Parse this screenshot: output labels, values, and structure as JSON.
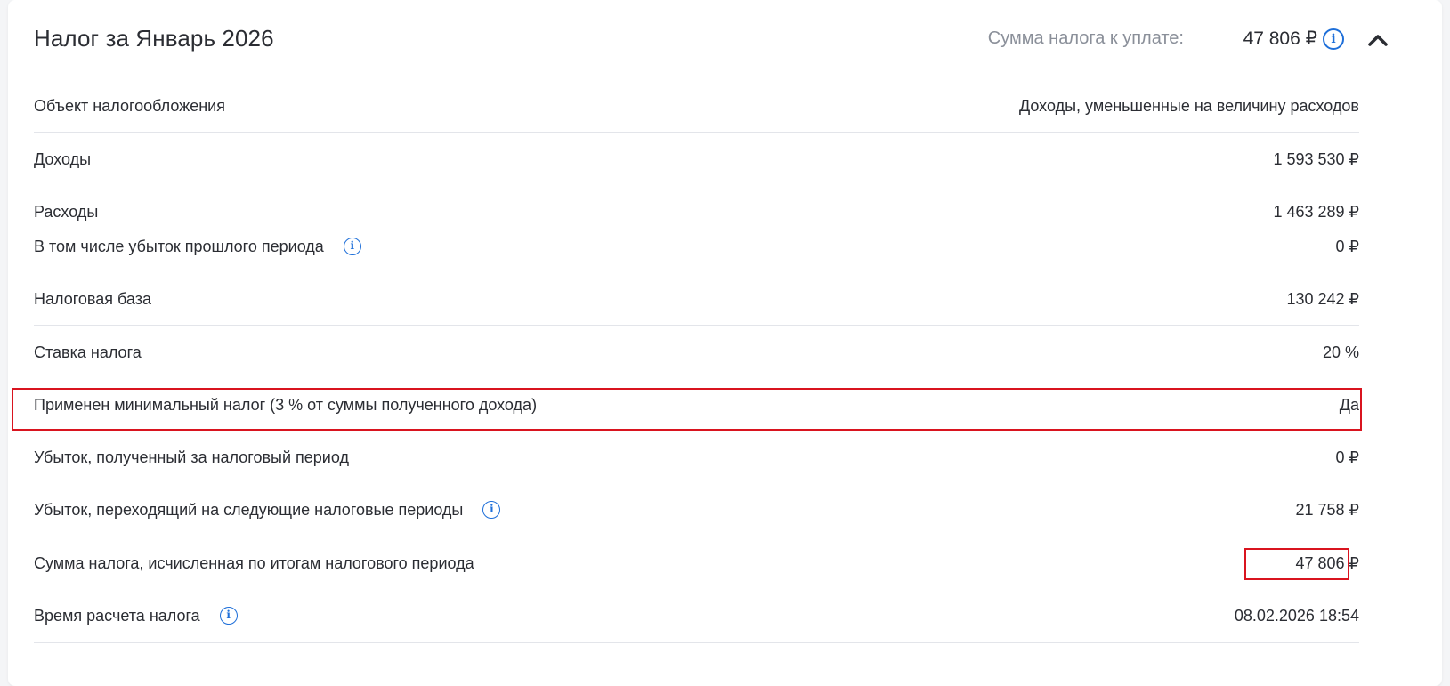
{
  "header": {
    "title": "Налог за Январь 2026",
    "summary_label": "Сумма налога к уплате:",
    "summary_value": "47 806 ₽"
  },
  "rows": [
    {
      "label": "Объект налогообложения",
      "value": "Доходы, уменьшенные на величину расходов"
    },
    {
      "label": "Доходы",
      "value": "1 593 530 ₽"
    },
    {
      "label": "Расходы",
      "value": "1 463 289 ₽"
    },
    {
      "label": "В том числе убыток прошлого периода",
      "value": "0 ₽"
    },
    {
      "label": "Налоговая база",
      "value": "130 242 ₽"
    },
    {
      "label": "Ставка налога",
      "value": "20 %"
    },
    {
      "label": "Применен минимальный налог (3 % от суммы полученного дохода)",
      "value": "Да"
    },
    {
      "label": "Убыток, полученный за налоговый период",
      "value": "0 ₽"
    },
    {
      "label": "Убыток, переходящий на следующие налоговые периоды",
      "value": "21 758 ₽"
    },
    {
      "label": "Сумма налога, исчисленная по итогам налогового периода",
      "value": "47 806 ₽"
    },
    {
      "label": "Время расчета налога",
      "value": "08.02.2026 18:54"
    }
  ],
  "icons": {
    "info": "info-icon",
    "collapse": "chevron-up-icon"
  },
  "colors": {
    "accent": "#1e6fd9",
    "highlight": "#d9141f",
    "text": "#2b2d33",
    "muted": "#8a8f99"
  }
}
